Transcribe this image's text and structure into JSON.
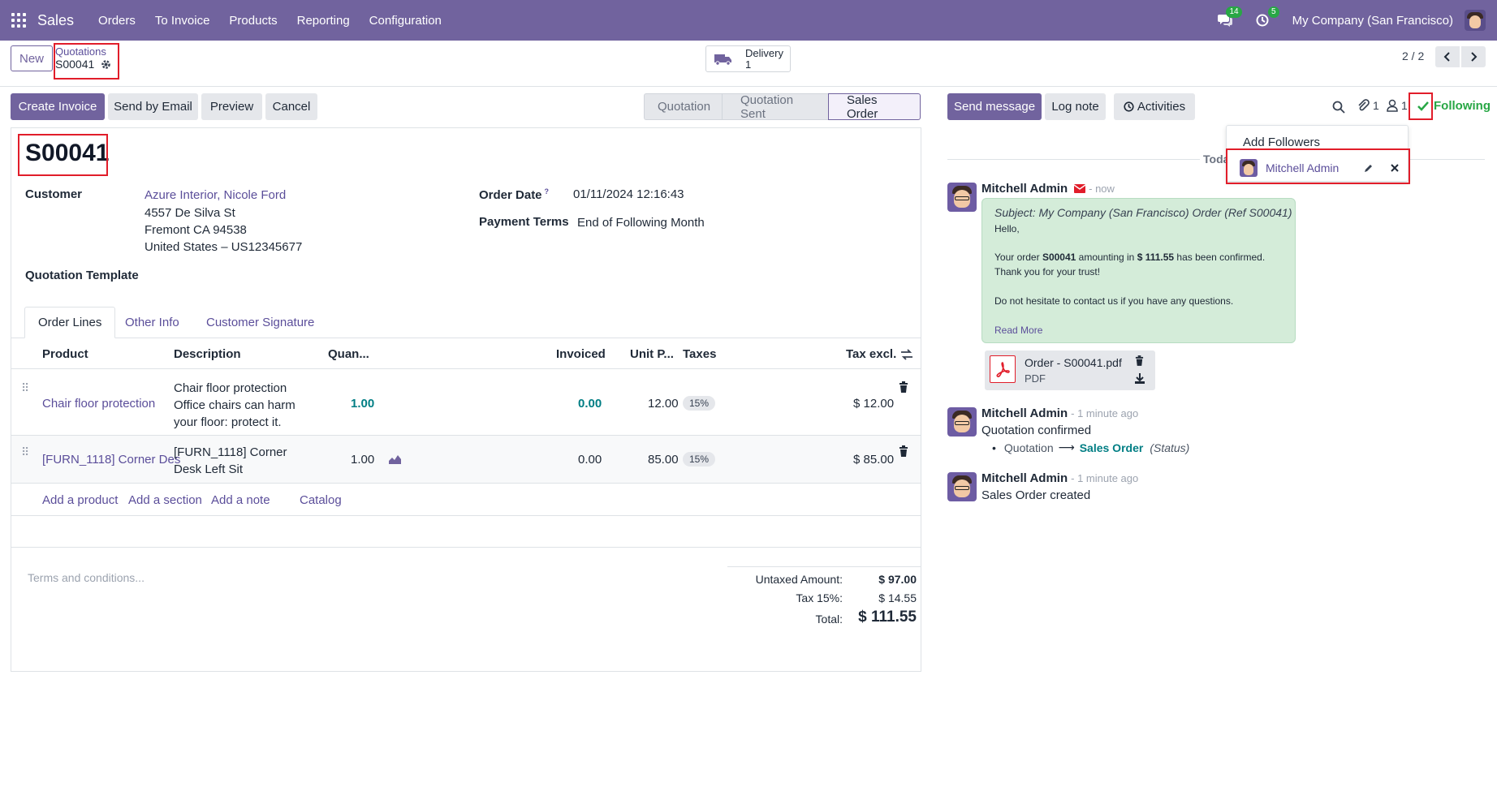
{
  "navbar": {
    "brand": "Sales",
    "menu": [
      "Orders",
      "To Invoice",
      "Products",
      "Reporting",
      "Configuration"
    ],
    "messages_count": "14",
    "activities_count": "5",
    "company": "My Company (San Francisco)"
  },
  "control": {
    "new_label": "New",
    "breadcrumb_parent": "Quotations",
    "breadcrumb_current": "S00041",
    "delivery_label": "Delivery",
    "delivery_count": "1",
    "pager": "2 / 2"
  },
  "actions": {
    "create_invoice": "Create Invoice",
    "send_email": "Send by Email",
    "preview": "Preview",
    "cancel": "Cancel"
  },
  "status": {
    "stages": [
      "Quotation",
      "Quotation Sent",
      "Sales Order"
    ],
    "active": "Sales Order"
  },
  "form": {
    "order_name": "S00041",
    "customer_label": "Customer",
    "customer_name": "Azure Interior, Nicole Ford",
    "address_1": "4557 De Silva St",
    "address_2": "Fremont CA 94538",
    "address_3": "United States – US12345677",
    "order_date_label": "Order Date",
    "order_date_help": "?",
    "order_date": "01/11/2024 12:16:43",
    "payment_terms_label": "Payment Terms",
    "payment_terms": "End of Following Month",
    "template_label": "Quotation Template",
    "tabs": [
      "Order Lines",
      "Other Info",
      "Customer Signature"
    ]
  },
  "lines": {
    "headers": {
      "product": "Product",
      "description": "Description",
      "quantity": "Quan...",
      "invoiced": "Invoiced",
      "unit_price": "Unit P...",
      "taxes": "Taxes",
      "tax_excl": "Tax excl."
    },
    "rows": [
      {
        "product": "Chair floor protection",
        "desc_1": "Chair floor protection",
        "desc_2": "Office chairs can harm",
        "desc_3": "your floor: protect it.",
        "quantity": "1.00",
        "invoiced": "0.00",
        "unit_price": "12.00",
        "tax": "15%",
        "subtotal": "$ 12.00"
      },
      {
        "product": "[FURN_1118] Corner Des",
        "desc_1": "[FURN_1118] Corner",
        "desc_2": "Desk Left Sit",
        "quantity": "1.00",
        "invoiced": "0.00",
        "unit_price": "85.00",
        "tax": "15%",
        "subtotal": "$ 85.00"
      }
    ],
    "add_product": "Add a product",
    "add_section": "Add a section",
    "add_note": "Add a note",
    "catalog": "Catalog"
  },
  "totals": {
    "terms_placeholder": "Terms and conditions...",
    "untaxed_label": "Untaxed Amount:",
    "untaxed": "$ 97.00",
    "tax_label": "Tax 15%:",
    "tax": "$ 14.55",
    "total_label": "Total:",
    "total": "$ 111.55"
  },
  "chatter": {
    "send_message": "Send message",
    "log_note": "Log note",
    "activities": "Activities",
    "attachments_count": "1",
    "followers_count": "1",
    "following": "Following",
    "add_followers": "Add Followers",
    "follower_name": "Mitchell Admin",
    "today_label": "Toda",
    "messages": [
      {
        "author": "Mitchell Admin",
        "time": "- now",
        "subject": "Subject: My Company (San Francisco) Order (Ref S00041)",
        "greeting": "Hello,",
        "body_pre": "Your order ",
        "body_order": "S00041",
        "body_mid": " amounting in ",
        "body_amount": "$ 111.55",
        "body_post": " has been confirmed.",
        "thanks": "Thank you for your trust!",
        "contact": "Do not hesitate to contact us if you have any questions.",
        "read_more": "Read More",
        "attachment_name": "Order - S00041.pdf",
        "attachment_type": "PDF"
      },
      {
        "author": "Mitchell Admin",
        "time": "- 1 minute ago",
        "text": "Quotation confirmed",
        "change_from": "Quotation",
        "change_to": "Sales Order",
        "change_field": "(Status)"
      },
      {
        "author": "Mitchell Admin",
        "time": "- 1 minute ago",
        "text": "Sales Order created"
      }
    ]
  }
}
